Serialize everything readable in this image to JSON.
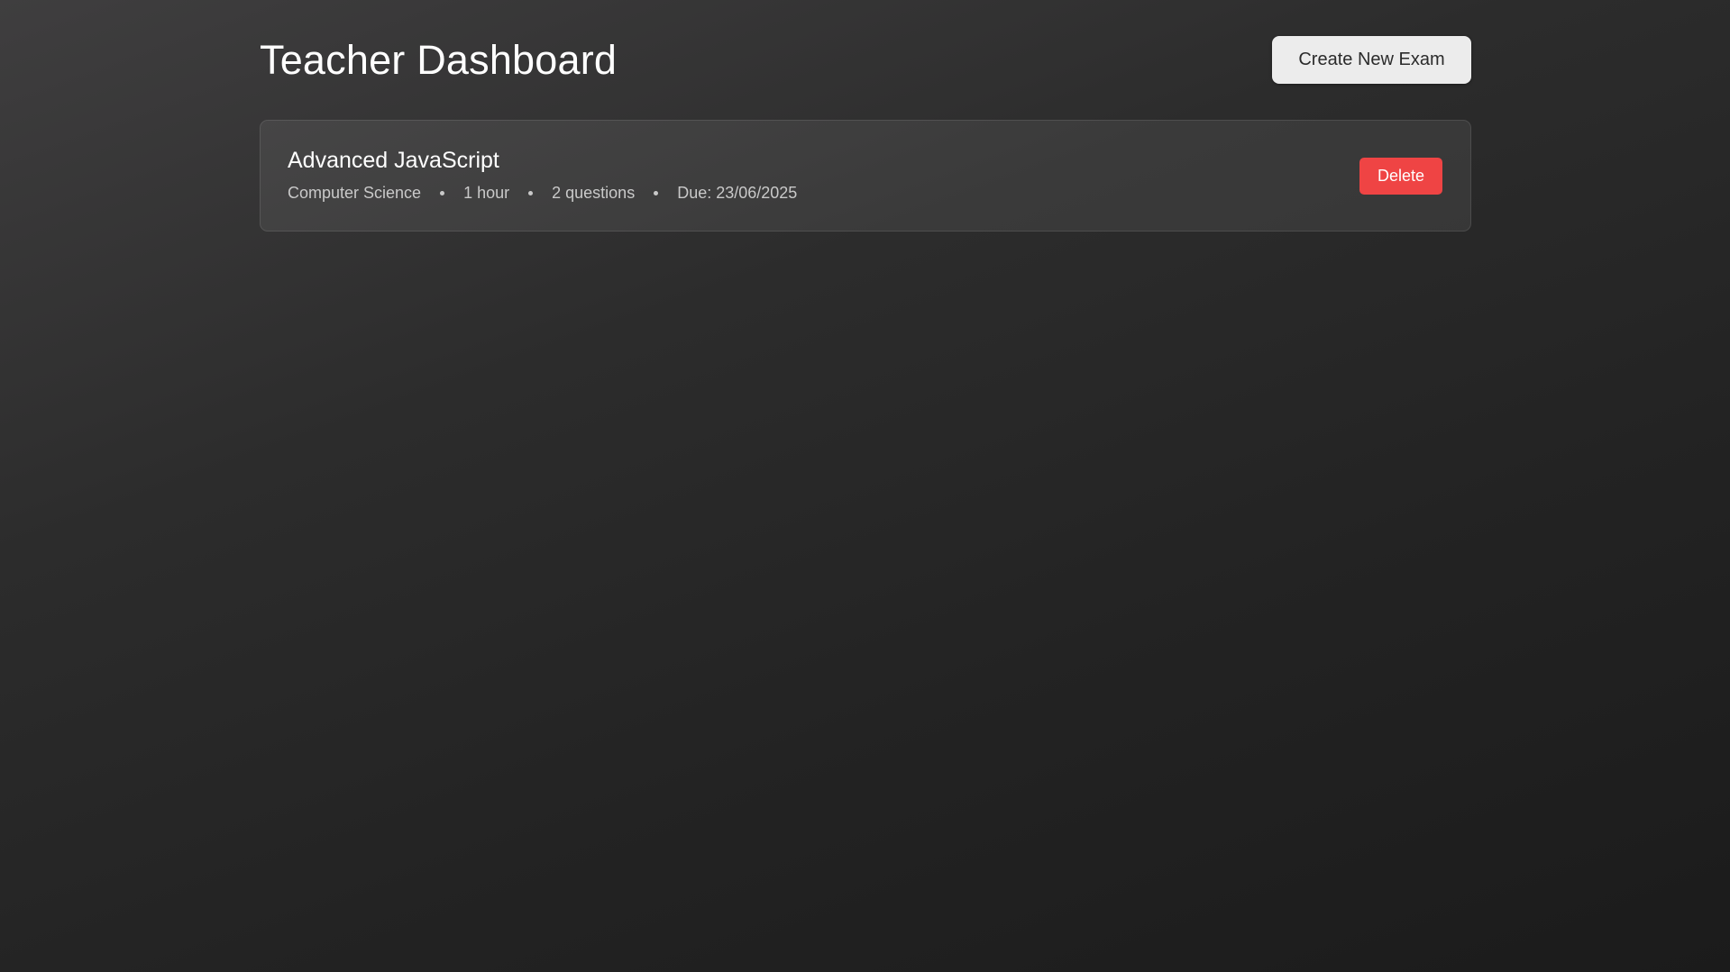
{
  "header": {
    "title": "Teacher Dashboard",
    "create_button_label": "Create New Exam"
  },
  "exams": [
    {
      "title": "Advanced JavaScript",
      "subject": "Computer Science",
      "duration": "1 hour",
      "questions": "2 questions",
      "due": "Due: 23/06/2025",
      "delete_label": "Delete"
    }
  ],
  "colors": {
    "delete_button": "#ef4444",
    "create_button": "#ececec"
  }
}
